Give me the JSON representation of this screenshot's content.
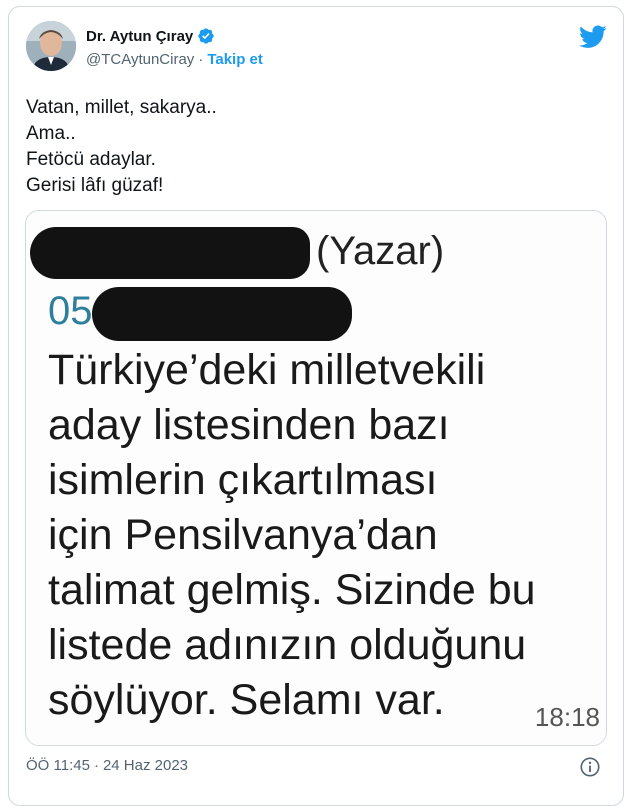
{
  "user": {
    "display_name": "Dr. Aytun Çıray",
    "handle": "@TCAytunCiray",
    "separator": "·",
    "follow_label": "Takip et"
  },
  "icons": {
    "verified": "verified-badge-icon",
    "brand": "twitter-bird-icon",
    "info": "info-icon"
  },
  "colors": {
    "accent": "#1d9bf0",
    "text_primary": "#0f1419",
    "text_secondary": "#536471"
  },
  "tweet": {
    "text": "Vatan, millet, sakarya..\nAma..\nFetöcü adaylar.\nGerisi lâfı güzaf!"
  },
  "media": {
    "author_suffix": "(Yazar)",
    "phone_prefix": "05",
    "message": "Türkiye’deki milletvekili\naday listesinden bazı\nisimlerin çıkartılması\niçin Pensilvanya’dan\ntalimat gelmiş. Sizinde bu\nlistede adınızın olduğunu\nsöylüyor. Selamı var.",
    "time": "18:18"
  },
  "footer": {
    "time": "ÖÖ 11:45",
    "separator": "·",
    "date": "24 Haz 2023"
  }
}
